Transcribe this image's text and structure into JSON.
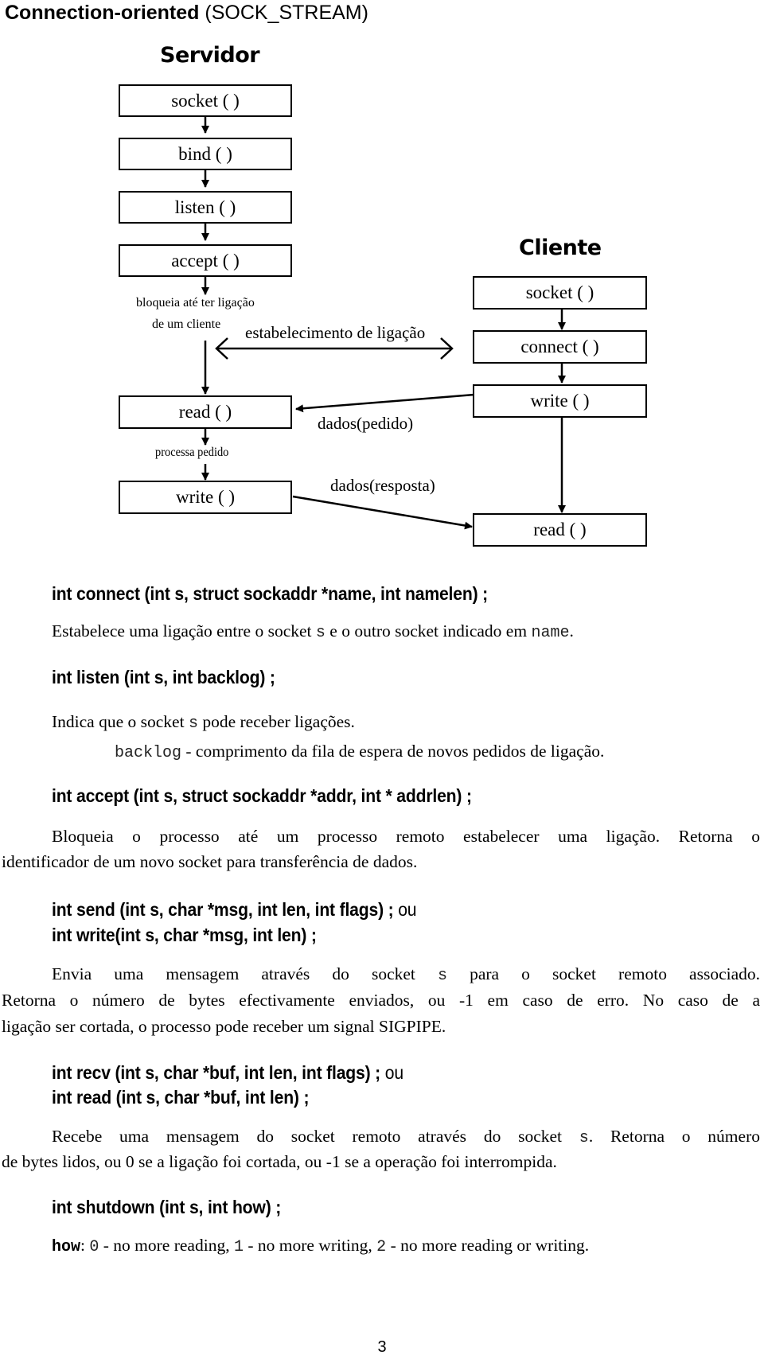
{
  "page": {
    "title_bold": "Connection-oriented",
    "title_plain": " (SOCK_STREAM)",
    "page_number": "3"
  },
  "diagram": {
    "server": {
      "label": "Servidor",
      "boxes": [
        "socket ( )",
        "bind ( )",
        "listen ( )",
        "accept ( )",
        "read ( )",
        "write ( )"
      ],
      "notes": {
        "blocks_line1": "bloqueia até ter ligação",
        "blocks_line2": "de um cliente",
        "process": "processa pedido"
      }
    },
    "client": {
      "label": "Cliente",
      "boxes": [
        "socket ( )",
        "connect ( )",
        "write ( )",
        "read ( )"
      ]
    },
    "links": {
      "connection": "estabelecimento de ligação",
      "request": "dados(pedido)",
      "response": "dados(resposta)"
    }
  },
  "functions": [
    {
      "signature": "int connect (int s, struct sockaddr *name, int namelen) ;",
      "desc_parts": [
        "Estabelece uma ligação entre o socket ",
        "s",
        " e o outro socket indicado em ",
        "name",
        "."
      ]
    },
    {
      "signature": "int listen (int s, int backlog) ;",
      "desc_parts": [
        "Indica que o socket ",
        "s",
        " pode receber ligações."
      ],
      "sub_parts": [
        "backlog",
        " - comprimento da fila de espera de novos pedidos de ligação."
      ]
    },
    {
      "signature": "int accept (int s, struct sockaddr *addr, int * addrlen) ;",
      "desc_line1": "Bloqueia o processo até um processo remoto estabelecer uma ligação. Retorna o",
      "desc_line2": "identificador de um novo socket para transferência de dados."
    },
    {
      "signature": "int send (int s, char *msg, int len, int flags) ;",
      "or_word": " ou",
      "signature2": "int write(int s, char *msg, int len) ;",
      "desc_line1_parts": [
        "Envia uma mensagem através do socket ",
        "s",
        " para o socket remoto associado."
      ],
      "desc_line2": "Retorna o número de bytes efectivamente enviados, ou -1 em caso de erro. No caso de a",
      "desc_line3": "ligação ser cortada, o processo pode receber um signal SIGPIPE."
    },
    {
      "signature": "int recv (int s, char *buf, int len, int flags) ;",
      "or_word": " ou",
      "signature2": "int read (int s, char *buf, int len) ;",
      "desc_line1_parts": [
        "Recebe uma mensagem do socket remoto através do socket ",
        "s",
        ". Retorna o número"
      ],
      "desc_line2": "de bytes lidos, ou 0 se a ligação foi cortada, ou -1 se a operação foi interrompida."
    },
    {
      "signature": "int shutdown (int s, int how) ;",
      "how_label": "how",
      "how_parts": [
        ": ",
        "0",
        " - no more reading, ",
        "1",
        " - no more writing, ",
        "2",
        " - no more reading or writing."
      ]
    }
  ]
}
